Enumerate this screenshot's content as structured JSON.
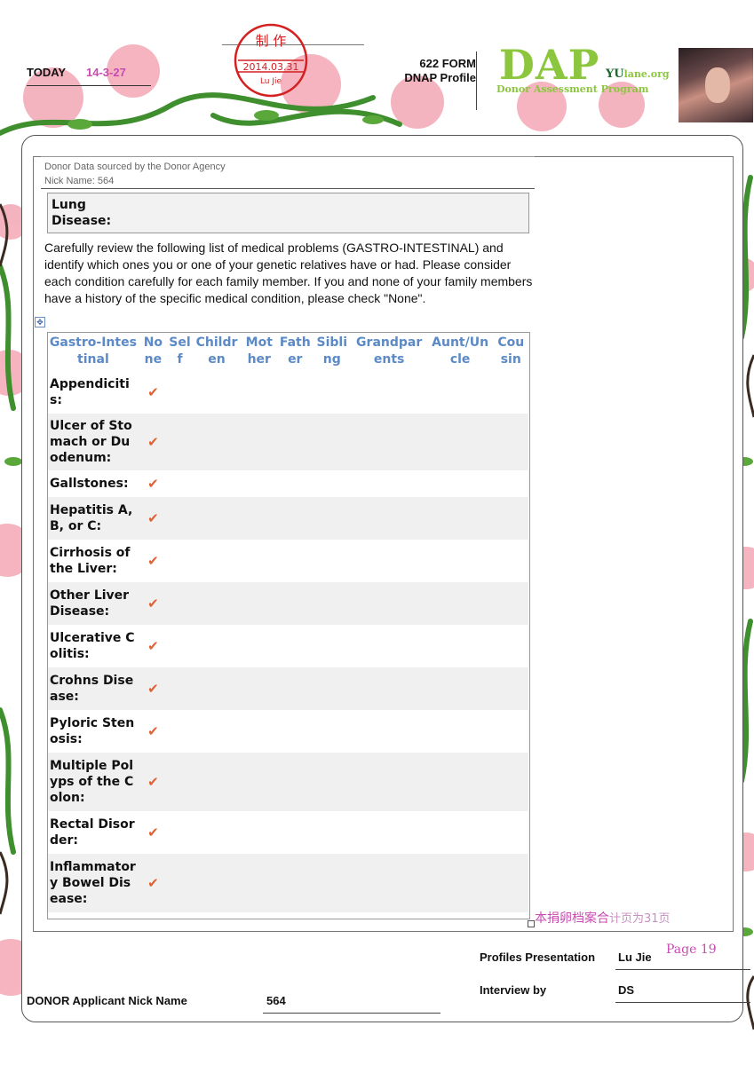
{
  "header": {
    "today_label": "TODAY",
    "today_value": "14-3-27",
    "stamp_top": "制 作",
    "stamp_date": "2014.03.31",
    "stamp_name": "Lu Jie",
    "form_title_line1": "622 FORM",
    "form_title_line2": "DNAP Profile",
    "logo_letters": "DAP",
    "logo_site_y": "YU",
    "logo_site_rest": "lane.org",
    "logo_subtitle": "Donor Assessment Program"
  },
  "doc": {
    "source_line": "Donor Data sourced by the Donor Agency",
    "nickname_line": "Nick Name: 564",
    "lung_disease_label": "Lung Disease:",
    "instructions": "Carefully review the following list of medical problems (GASTRO-INTESTINAL) and identify which ones you or one of your genetic relatives have or had. Please consider each condition carefully for each family member. If you and none of your family members have a history of the specific medical condition, please check \"None\"."
  },
  "table": {
    "headers": [
      "Gastro-Intestinal",
      "None",
      "Self",
      "Children",
      "Mother",
      "Father",
      "Sibling",
      "Grandparents",
      "Aunt/Uncle",
      "Cousin"
    ],
    "rows": [
      {
        "condition": "Appendicitis:",
        "none": "✔"
      },
      {
        "condition": "Ulcer of Stomach or Duodenum:",
        "none": "✔"
      },
      {
        "condition": "Gallstones:",
        "none": "✔"
      },
      {
        "condition": "Hepatitis A, B, or C:",
        "none": "✔"
      },
      {
        "condition": "Cirrhosis of the Liver:",
        "none": "✔"
      },
      {
        "condition": "Other Liver Disease:",
        "none": "✔"
      },
      {
        "condition": "Ulcerative Colitis:",
        "none": "✔"
      },
      {
        "condition": "Crohns Disease:",
        "none": "✔"
      },
      {
        "condition": "Pyloric Stenosis:",
        "none": "✔"
      },
      {
        "condition": "Multiple Polyps of the Colon:",
        "none": "✔"
      },
      {
        "condition": "Rectal Disorder:",
        "none": "✔"
      },
      {
        "condition": "Inflammatory Bowel Disease:",
        "none": "✔"
      }
    ]
  },
  "chinese_note_strong": "本捐卵档案合",
  "chinese_note_light": "计页为31页",
  "footer": {
    "presentation_label": "Profiles Presentation",
    "presentation_value": "Lu Jie",
    "page_label": "Page 19",
    "interview_label": "Interview by",
    "interview_value": "DS",
    "applicant_label": "DONOR Applicant Nick Name",
    "applicant_value": "564"
  },
  "colors": {
    "accent_pink": "#c74bb0",
    "header_blue": "#5b8ac6",
    "logo_green": "#8cc63f",
    "stamp_red": "#d42020",
    "check_orange": "#e06030"
  }
}
